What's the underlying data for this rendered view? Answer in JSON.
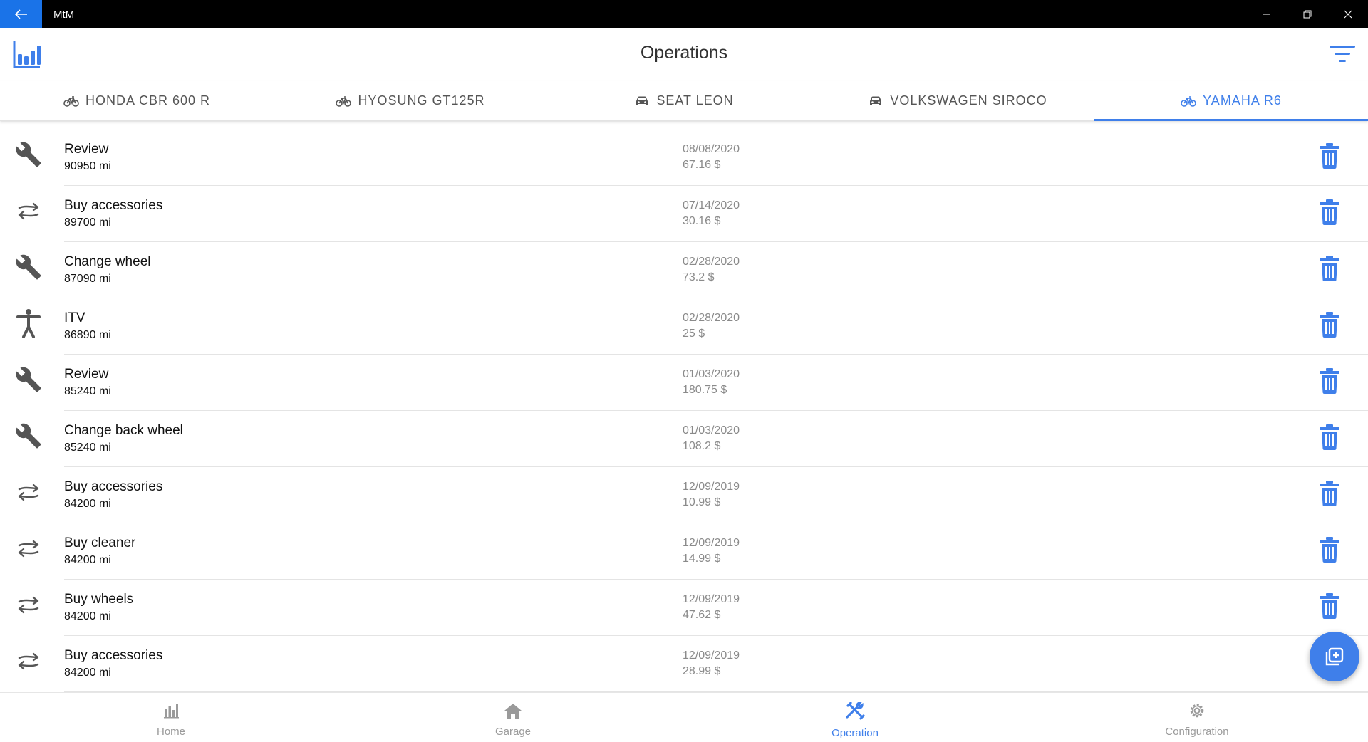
{
  "window": {
    "title": "MtM"
  },
  "header": {
    "title": "Operations"
  },
  "tabs": [
    {
      "label": "HONDA CBR 600 R",
      "icon": "bicycle-icon",
      "active": false
    },
    {
      "label": "HYOSUNG GT125R",
      "icon": "bicycle-icon",
      "active": false
    },
    {
      "label": "SEAT LEON",
      "icon": "car-icon",
      "active": false
    },
    {
      "label": "VOLKSWAGEN SIROCO",
      "icon": "car-icon",
      "active": false
    },
    {
      "label": "YAMAHA R6",
      "icon": "bicycle-icon",
      "active": true
    }
  ],
  "operations": [
    {
      "name": "Review",
      "mileage": "90950 mi",
      "date": "08/08/2020",
      "cost": "67.16 $",
      "icon": "wrench-icon"
    },
    {
      "name": "Buy accessories",
      "mileage": "89700 mi",
      "date": "07/14/2020",
      "cost": "30.16 $",
      "icon": "swap-icon"
    },
    {
      "name": "Change wheel",
      "mileage": "87090 mi",
      "date": "02/28/2020",
      "cost": "73.2 $",
      "icon": "wrench-icon"
    },
    {
      "name": "ITV",
      "mileage": "86890 mi",
      "date": "02/28/2020",
      "cost": "25 $",
      "icon": "accessibility-icon"
    },
    {
      "name": "Review",
      "mileage": "85240 mi",
      "date": "01/03/2020",
      "cost": "180.75 $",
      "icon": "wrench-icon"
    },
    {
      "name": "Change back wheel",
      "mileage": "85240 mi",
      "date": "01/03/2020",
      "cost": "108.2 $",
      "icon": "wrench-icon"
    },
    {
      "name": "Buy accessories",
      "mileage": "84200 mi",
      "date": "12/09/2019",
      "cost": "10.99 $",
      "icon": "swap-icon"
    },
    {
      "name": "Buy cleaner",
      "mileage": "84200 mi",
      "date": "12/09/2019",
      "cost": "14.99 $",
      "icon": "swap-icon"
    },
    {
      "name": "Buy wheels",
      "mileage": "84200 mi",
      "date": "12/09/2019",
      "cost": "47.62 $",
      "icon": "swap-icon"
    },
    {
      "name": "Buy accessories",
      "mileage": "84200 mi",
      "date": "12/09/2019",
      "cost": "28.99 $",
      "icon": "swap-icon"
    }
  ],
  "bottom_nav": [
    {
      "label": "Home",
      "icon": "bar-chart-icon",
      "active": false
    },
    {
      "label": "Garage",
      "icon": "home-icon",
      "active": false
    },
    {
      "label": "Operation",
      "icon": "tools-icon",
      "active": true
    },
    {
      "label": "Configuration",
      "icon": "gear-icon",
      "active": false
    }
  ],
  "colors": {
    "accent": "#3f7fea",
    "titlebar": "#000000",
    "back_button": "#1a73e8",
    "icon_gray": "#555555",
    "muted_text": "#8a8a8a"
  }
}
